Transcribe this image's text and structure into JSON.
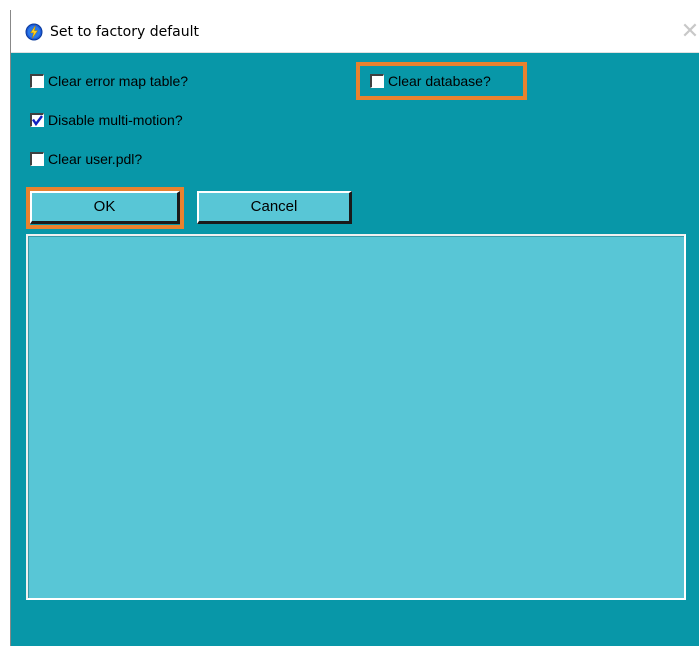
{
  "window": {
    "title": "Set to factory default",
    "app_icon": "lightning-bolt-icon",
    "close_glyph": "✕",
    "background_color": "#0897a8"
  },
  "options": {
    "clear_error_map": {
      "label": "Clear error map table?",
      "checked": false
    },
    "clear_database": {
      "label": "Clear database?",
      "checked": false
    },
    "disable_multi_motion": {
      "label": "Disable multi-motion?",
      "checked": true
    },
    "clear_user_pdl": {
      "label": "Clear user.pdl?",
      "checked": false
    }
  },
  "buttons": {
    "ok_label": "OK",
    "cancel_label": "Cancel"
  },
  "highlights": {
    "color": "#e8822e",
    "targets": [
      "clear_database",
      "ok_button"
    ]
  },
  "log_area": {
    "content": "",
    "background_color": "#58c6d6"
  }
}
